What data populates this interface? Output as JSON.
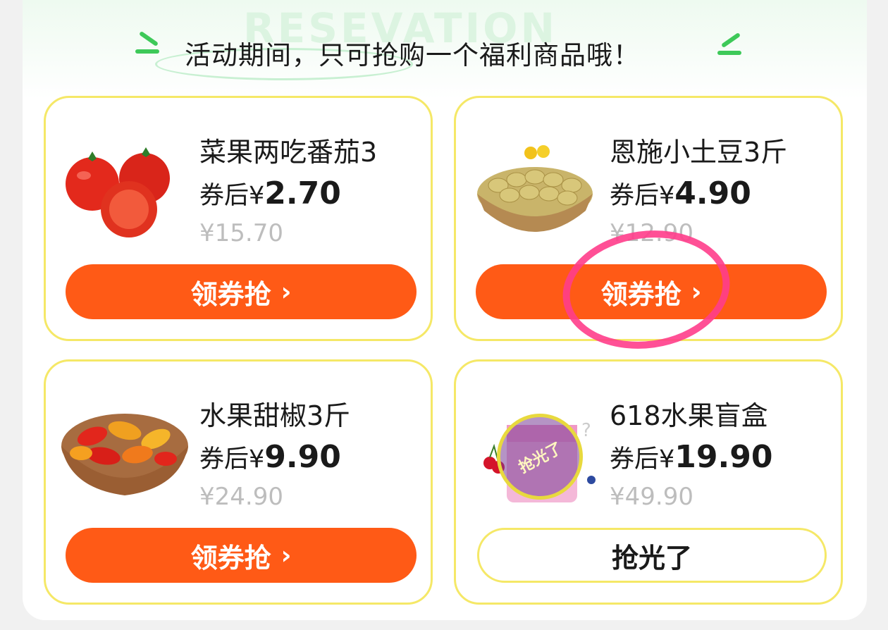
{
  "banner": {
    "watermark": "RESEVATION",
    "heading": "活动期间，只可抢购一个福利商品哦！"
  },
  "products": [
    {
      "name": "菜果两吃番茄3",
      "price_prefix": "券后¥",
      "price": "2.70",
      "original": "¥15.70",
      "button": "领券抢",
      "chevron": "›",
      "icon": "tomato-image"
    },
    {
      "name": "恩施小土豆3斤",
      "price_prefix": "券后¥",
      "price": "4.90",
      "original": "¥12.90",
      "button": "领券抢",
      "chevron": "›",
      "icon": "potato-basket-image"
    },
    {
      "name": "水果甜椒3斤",
      "price_prefix": "券后¥",
      "price": "9.90",
      "original": "¥24.90",
      "button": "领券抢",
      "chevron": "›",
      "icon": "pepper-basket-image"
    },
    {
      "name": "618水果盲盒",
      "price_prefix": "券后¥",
      "price": "19.90",
      "original": "¥49.90",
      "button": "抢光了",
      "stamp": "抢光了",
      "icon": "fruit-blind-box-image"
    }
  ],
  "colors": {
    "accent": "#ff5a16",
    "card_border": "#f5e867",
    "annotation": "#ff3d8b",
    "green": "#3ec959"
  }
}
